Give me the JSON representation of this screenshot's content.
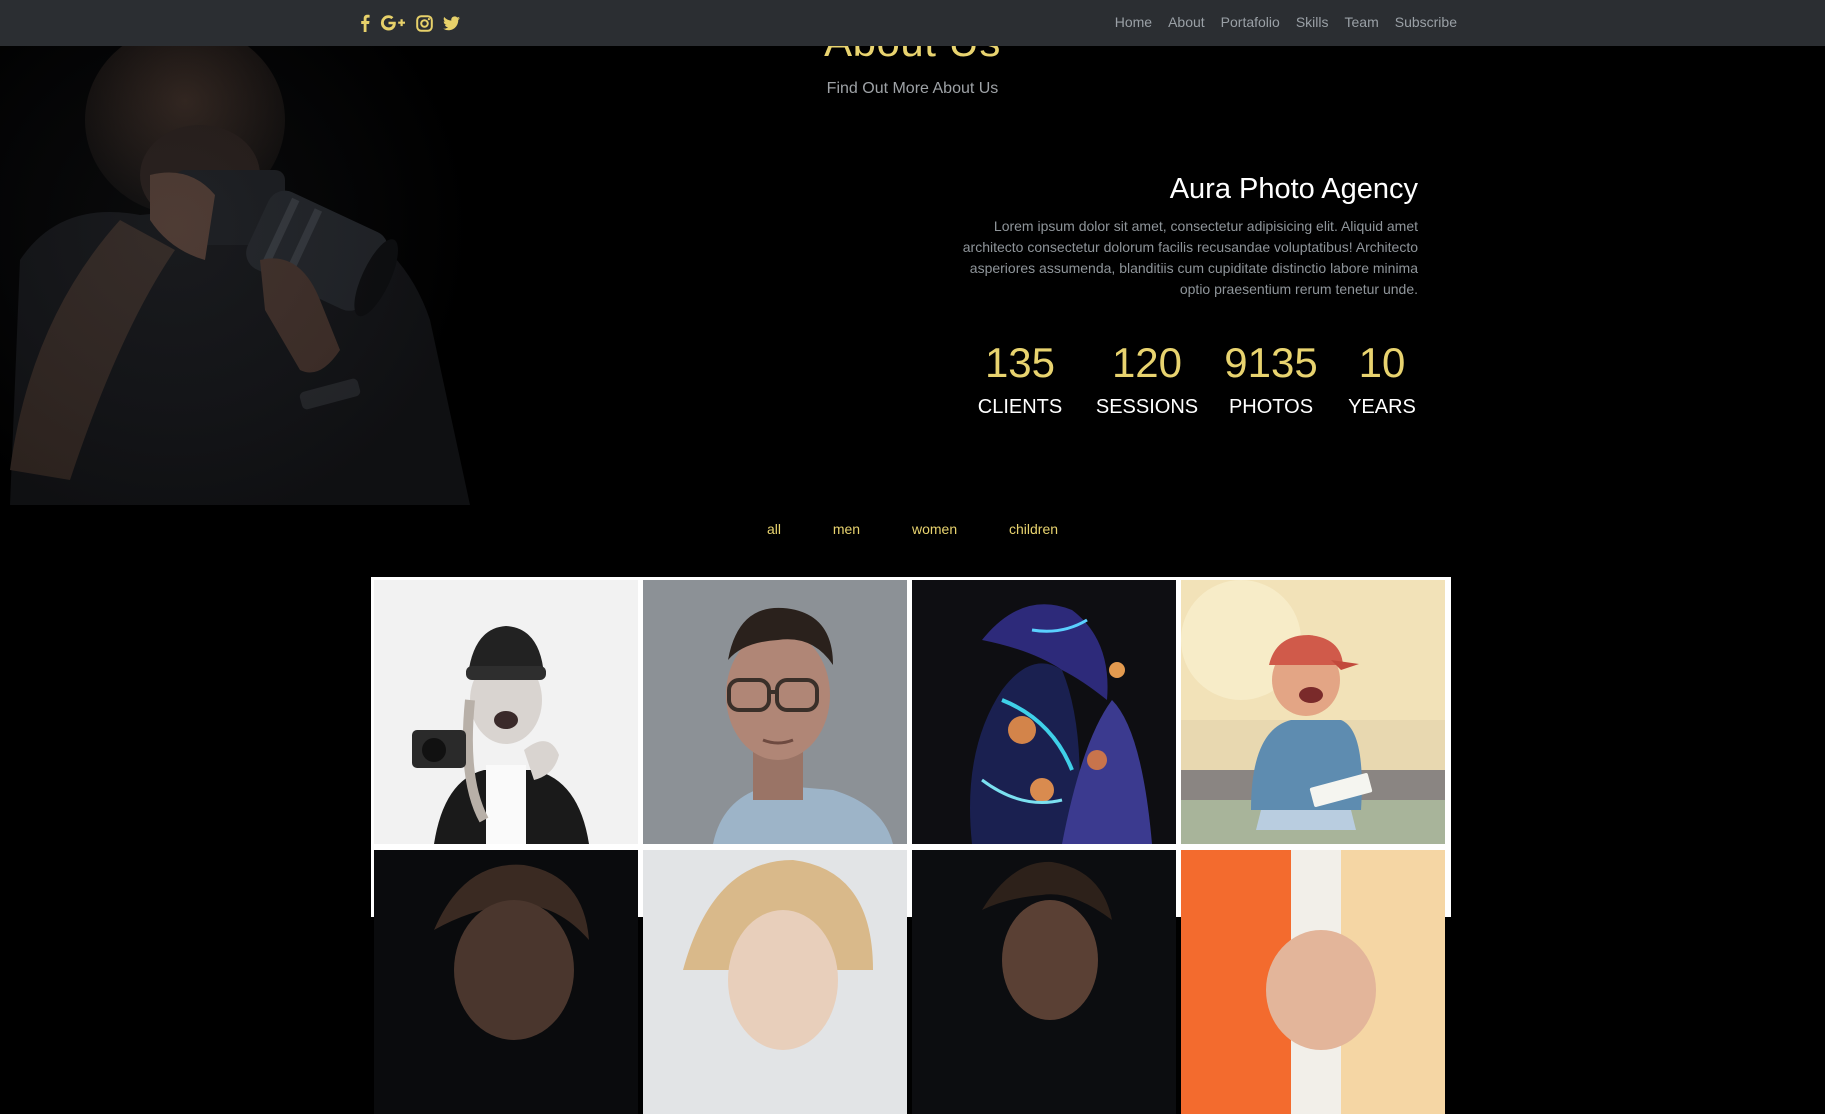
{
  "nav": {
    "social_icons": [
      "facebook-icon",
      "google-plus-icon",
      "instagram-icon",
      "twitter-icon"
    ],
    "links": [
      "Home",
      "About",
      "Portafolio",
      "Skills",
      "Team",
      "Subscribe"
    ]
  },
  "about": {
    "title": "About Us",
    "subtitle": "Find Out More About Us",
    "agency_title": "Aura Photo Agency",
    "agency_text": "Lorem ipsum dolor sit amet, consectetur adipisicing elit. Aliquid amet architecto consectetur dolorum facilis recusandae voluptatibus! Architecto asperiores assumenda, blanditiis cum cupiditate distinctio labore minima optio praesentium rerum tenetur unde.",
    "stats": [
      {
        "number": "135",
        "label": "CLIENTS"
      },
      {
        "number": "120",
        "label": "SESSIONS"
      },
      {
        "number": "9135",
        "label": "PHOTOS"
      },
      {
        "number": "10",
        "label": "YEARS"
      }
    ]
  },
  "filters": [
    "all",
    "men",
    "women",
    "children"
  ],
  "gallery": {
    "photos": [
      "woman-with-camera",
      "man-with-glasses",
      "body-paint-woman",
      "laughing-boy",
      "man-partial",
      "blonde-person-partial",
      "dark-haired-person-partial",
      "child-orange-background-partial"
    ]
  },
  "colors": {
    "accent": "#e8d36f",
    "navbar": "#2b2e32",
    "background": "#000000",
    "muted_text": "#9ea2a6"
  }
}
